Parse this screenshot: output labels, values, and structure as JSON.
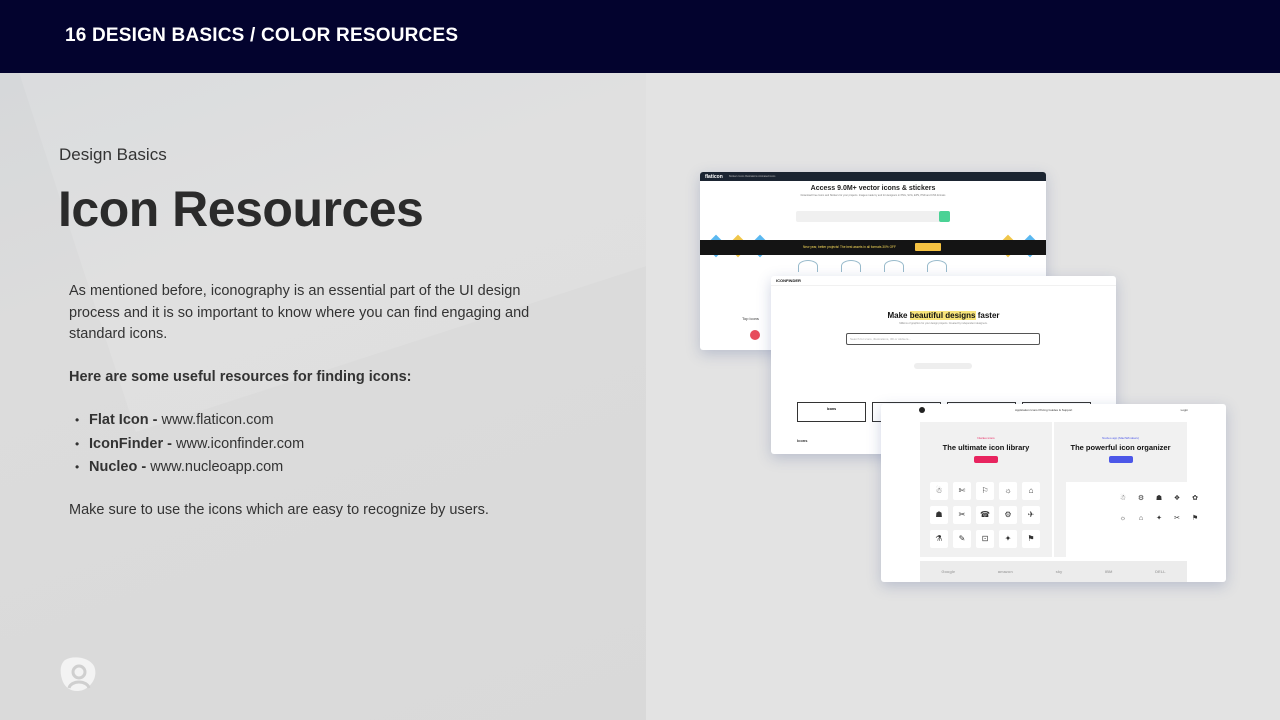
{
  "header": {
    "title": "16 DESIGN BASICS / COLOR RESOURCES"
  },
  "slide": {
    "eyebrow": "Design Basics",
    "headline": "Icon Resources",
    "intro": "As mentioned before, iconography is an essential part of the UI design process and it is so important to know where you can find engaging and standard icons.",
    "resources_lead": "Here are some useful resources for finding icons:",
    "resources": [
      {
        "name": "Flat Icon -",
        "url": "www.flaticon.com"
      },
      {
        "name": "IconFinder -",
        "url": "www.iconfinder.com"
      },
      {
        "name": "Nucleo -",
        "url": "www.nucleoapp.com"
      }
    ],
    "closing": "Make sure to use the icons which are easy to recognize by users.",
    "bullet_glyph": "•"
  },
  "screenshots": {
    "flaticon": {
      "logo": "flaticon",
      "nav": "Stickers   Icons   Illustrations   Animated icons",
      "heading": "Access 9.0M+ vector icons & stickers",
      "subheading": "Download Free Icons and Stickers for your projects. Images made by and for designers in PNG, SVG, EPS, PSD and CSS formats",
      "banner": "New year, better projects!   The best assets in all formats 30% OFF",
      "section": "Top icons"
    },
    "iconfinder": {
      "logo": "ICONFINDER",
      "heading_pre": "Make ",
      "heading_hl": "beautiful designs",
      "heading_post": " faster",
      "subheading": "Millions of graphics for your design projects. Created by independent designers.",
      "search_placeholder": "Search for icons, illustrations, 3D or stickers...",
      "box_label": "Icons",
      "footer": "Icons"
    },
    "nucleo": {
      "nav": "Application   Icons   Pricing   Guides & Support",
      "login": "Login",
      "left_tag": "Nucleo icons",
      "left_heading": "The ultimate icon library",
      "left_btn_color": "#e8245f",
      "right_tag": "Nucleo app (Mac/Windows)",
      "right_heading": "The powerful icon organizer",
      "right_btn_color": "#4c57e8",
      "left_icons": [
        "☃",
        "✄",
        "⚐",
        "☼",
        "⌂",
        "☗",
        "✂",
        "☎",
        "⚙",
        "✈",
        "⚗",
        "✎",
        "⊡",
        "✦",
        "⚑"
      ],
      "right_icons": [
        "☃",
        "⚙",
        "☗",
        "❖",
        "✿",
        "☼",
        "⌂",
        "✦",
        "✂",
        "⚑"
      ],
      "logos": [
        "Google",
        "amazon",
        "sky",
        "IBM",
        "DELL"
      ]
    }
  },
  "colors": {
    "navy": "#03032e",
    "text": "#333333",
    "headline": "#2b2b2b"
  }
}
